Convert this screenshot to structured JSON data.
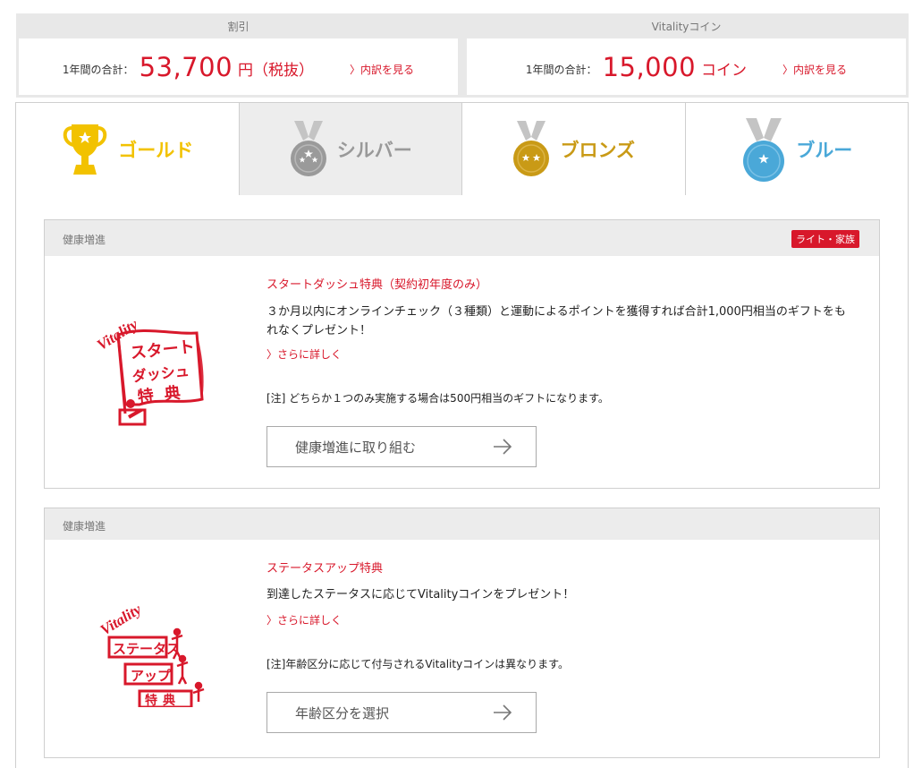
{
  "summary": {
    "discount": {
      "header": "割引",
      "label": "1年間の合計：",
      "amount": "53,700",
      "unit": "円（税抜）",
      "link": "〉内訳を見る"
    },
    "coins": {
      "header": "Vitalityコイン",
      "label": "1年間の合計：",
      "amount": "15,000",
      "unit": "コイン",
      "link": "〉内訳を見る"
    }
  },
  "tabs": [
    {
      "label": "ゴールド",
      "color": "#f2c200",
      "active": false
    },
    {
      "label": "シルバー",
      "color": "#999999",
      "active": true
    },
    {
      "label": "ブロンズ",
      "color": "#c99a16",
      "active": false
    },
    {
      "label": "ブルー",
      "color": "#4aa8d8",
      "active": false
    }
  ],
  "cards": [
    {
      "category": "健康増進",
      "badge": "ライト・家族",
      "title": "スタートダッシュ特典（契約初年度のみ）",
      "description": "３か月以内にオンラインチェック（３種類）と運動によるポイントを獲得すれば合計1,000円相当のギフトをもれなくプレゼント！",
      "more": "〉さらに詳しく",
      "note": "[注] どちらか１つのみ実施する場合は500円相当のギフトになります。",
      "button": "健康増進に取り組む",
      "logo": {
        "brand": "Vitality",
        "lines": [
          "スタート",
          "ダッシュ",
          "特典"
        ]
      }
    },
    {
      "category": "健康増進",
      "title": "ステータスアップ特典",
      "description": "到達したステータスに応じてVitalityコインをプレゼント！",
      "more": "〉さらに詳しく",
      "note": "[注]年齢区分に応じて付与されるVitalityコインは異なります。",
      "button": "年齢区分を選択",
      "logo": {
        "brand": "Vitality",
        "lines": [
          "ステータス",
          "アップ",
          "特典"
        ]
      }
    }
  ],
  "colors": {
    "accent": "#d8182b"
  }
}
